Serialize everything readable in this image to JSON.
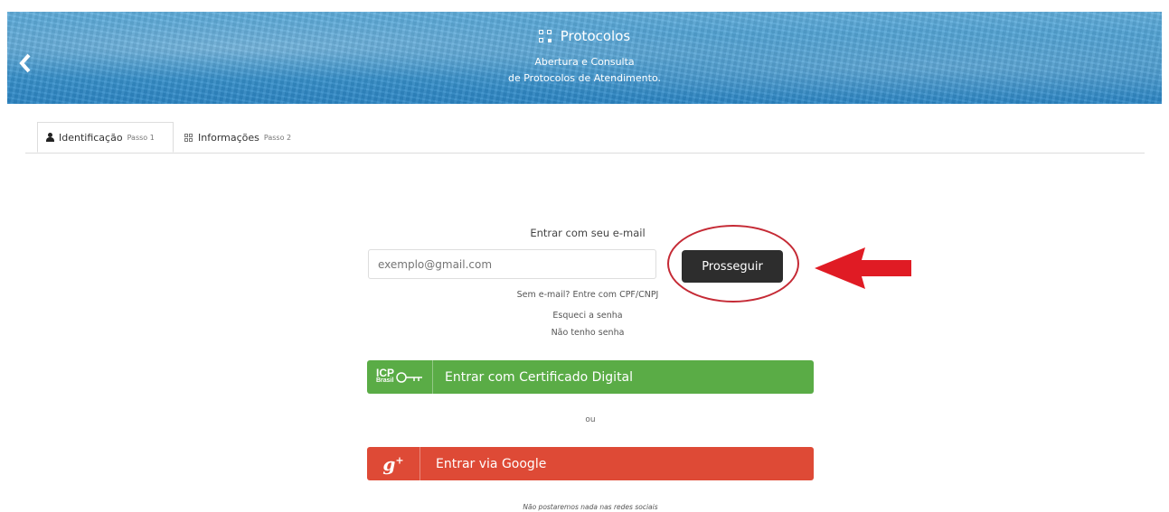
{
  "header": {
    "title": "Protocolos",
    "subtitle_line1": "Abertura e Consulta",
    "subtitle_line2": "de Protocolos de Atendimento."
  },
  "tabs": [
    {
      "label": "Identificação",
      "step": "Passo 1",
      "active": true
    },
    {
      "label": "Informações",
      "step": "Passo 2",
      "active": false
    }
  ],
  "form": {
    "email_label": "Entrar com seu e-mail",
    "email_placeholder": "exemplo@gmail.com",
    "submit_label": "Prosseguir",
    "links": {
      "no_email": "Sem e-mail? Entre com CPF/CNPJ",
      "forgot_password": "Esqueci a senha",
      "no_password": "Não tenho senha"
    },
    "certificate_button": "Entrar com Certificado Digital",
    "icp_logo_text": "ICP",
    "icp_logo_sub": "Brasil",
    "separator": "ou",
    "google_button": "Entrar via Google",
    "disclaimer": "Não postaremos nada nas redes sociais"
  },
  "colors": {
    "banner": "#3f97cf",
    "submit": "#2d2d2d",
    "certificate": "#5aac46",
    "google": "#de4a36",
    "annotation": "#c52a35",
    "arrow": "#e01b24"
  }
}
